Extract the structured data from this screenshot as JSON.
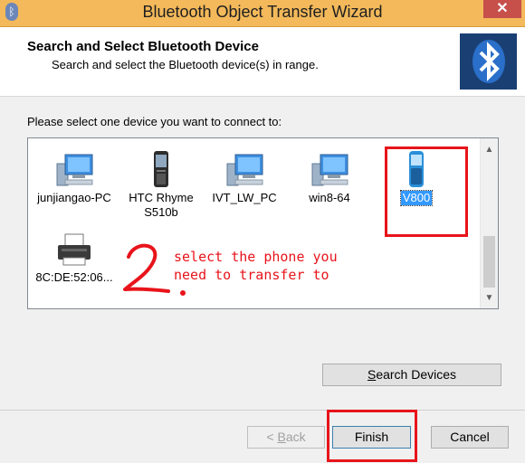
{
  "window": {
    "title": "Bluetooth Object Transfer Wizard",
    "close_glyph": "✕"
  },
  "header": {
    "title": "Search and Select Bluetooth Device",
    "subtitle": "Search and select the Bluetooth device(s) in range.",
    "logo_icon": "bluetooth-icon"
  },
  "prompt": "Please select one device you want to connect to:",
  "devices": [
    {
      "label": "junjiangao-PC",
      "icon": "computer-icon"
    },
    {
      "label": "HTC Rhyme\nS510b",
      "label_line1": "HTC Rhyme",
      "label_line2": "S510b",
      "icon": "phone-icon"
    },
    {
      "label": "IVT_LW_PC",
      "icon": "computer-icon"
    },
    {
      "label": "win8-64",
      "icon": "computer-icon"
    },
    {
      "label": "V800",
      "icon": "phone-icon",
      "selected": true
    },
    {
      "label": "8C:DE:52:06...",
      "icon": "printer-icon"
    }
  ],
  "annotation": {
    "step_number": "2.",
    "line1": "select the phone you",
    "line2": "need to transfer to",
    "color": "#e8141b"
  },
  "buttons": {
    "search_prefix": "S",
    "search_rest": "earch Devices",
    "back_prefix": "< ",
    "back_ul": "B",
    "back_rest": "ack",
    "finish": "Finish",
    "cancel": "Cancel"
  },
  "colors": {
    "titlebar": "#f3b95a",
    "selection": "#3399ff",
    "logo_bg": "#1a3f73"
  }
}
